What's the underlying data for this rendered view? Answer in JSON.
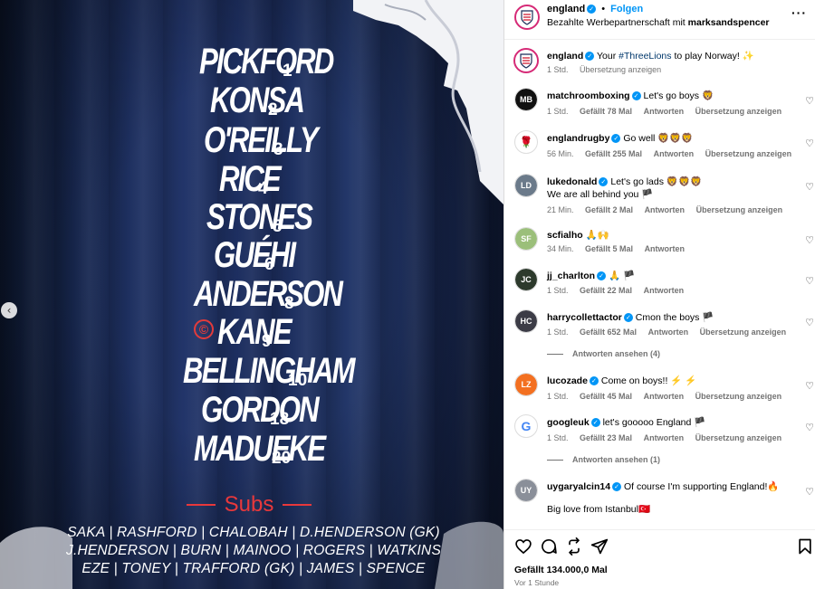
{
  "post_image": {
    "starting_xi": [
      {
        "name": "PICKFORD",
        "number": "1"
      },
      {
        "name": "KONSA",
        "number": "2"
      },
      {
        "name": "O'REILLY",
        "number": "3"
      },
      {
        "name": "RICE",
        "number": "4"
      },
      {
        "name": "STONES",
        "number": "5"
      },
      {
        "name": "GUÉHI",
        "number": "6"
      },
      {
        "name": "ANDERSON",
        "number": "8"
      },
      {
        "name": "KANE",
        "number": "9"
      },
      {
        "name": "BELLINGHAM",
        "number": "10"
      },
      {
        "name": "GORDON",
        "number": "18"
      },
      {
        "name": "MADUEKE",
        "number": "20"
      }
    ],
    "captain_mark": "©",
    "subs_title": "Subs",
    "subs_lines": [
      "SAKA | RASHFORD | CHALOBAH | D.HENDERSON (GK)",
      "J.HENDERSON | BURN | MAINOO | ROGERS | WATKINS",
      "EZE | TONEY | TRAFFORD (GK) | JAMES | SPENCE"
    ],
    "carousel_prev_icon": "‹"
  },
  "header": {
    "username": "england",
    "follow_label": "Folgen",
    "separator": "•",
    "partnership_prefix": "Bezahlte Werbepartnerschaft mit",
    "partner": "marksandspencer",
    "more_icon": "···"
  },
  "caption": {
    "username": "england",
    "text_before": "Your",
    "hashtag": "#ThreeLions",
    "text_after": "to play Norway! ✨",
    "time": "1 Std.",
    "translate": "Übersetzung anzeigen"
  },
  "comments": [
    {
      "username": "matchroomboxing",
      "verified": true,
      "text": "Let's go boys 🦁",
      "time": "1 Std.",
      "likes": "Gefällt 78 Mal",
      "reply": "Antworten",
      "translate": "Übersetzung anzeigen",
      "avatar_color": "#111111",
      "avatar_text": "MB"
    },
    {
      "username": "englandrugby",
      "verified": true,
      "text": "Go well 🦁🦁🦁",
      "time": "56 Min.",
      "likes": "Gefällt 255 Mal",
      "reply": "Antworten",
      "translate": "Übersetzung anzeigen",
      "avatar_color": "#ffffff",
      "avatar_text": "🌹"
    },
    {
      "username": "lukedonald",
      "verified": true,
      "text": "Let's go lads 🦁🦁🦁",
      "text2": "We are all behind you 🏴",
      "time": "21 Min.",
      "likes": "Gefällt 2 Mal",
      "reply": "Antworten",
      "translate": "Übersetzung anzeigen",
      "avatar_color": "#6b7a8a",
      "avatar_text": "LD"
    },
    {
      "username": "scfialho",
      "verified": false,
      "text": "🙏🙌",
      "time": "34 Min.",
      "likes": "Gefällt 5 Mal",
      "reply": "Antworten",
      "avatar_color": "#9bbf7a",
      "avatar_text": "SF"
    },
    {
      "username": "jj_charlton",
      "verified": true,
      "text": "🙏 🏴",
      "time": "1 Std.",
      "likes": "Gefällt 22 Mal",
      "reply": "Antworten",
      "avatar_color": "#2d3a2c",
      "avatar_text": "JC"
    },
    {
      "username": "harrycollettactor",
      "verified": true,
      "text": "Cmon the boys 🏴",
      "time": "1 Std.",
      "likes": "Gefällt 652 Mal",
      "reply": "Antworten",
      "translate": "Übersetzung anzeigen",
      "view_replies": "Antworten ansehen (4)",
      "avatar_color": "#3c3c46",
      "avatar_text": "HC"
    },
    {
      "username": "lucozade",
      "verified": true,
      "text": "Come on boys!! ⚡ ⚡",
      "time": "1 Std.",
      "likes": "Gefällt 45 Mal",
      "reply": "Antworten",
      "translate": "Übersetzung anzeigen",
      "avatar_color": "#f37021",
      "avatar_text": "LZ"
    },
    {
      "username": "googleuk",
      "verified": true,
      "text": "let's gooooo England 🏴",
      "time": "1 Std.",
      "likes": "Gefällt 23 Mal",
      "reply": "Antworten",
      "translate": "Übersetzung anzeigen",
      "view_replies": "Antworten ansehen (1)",
      "avatar_color": "#ffffff",
      "avatar_text": "G"
    },
    {
      "username": "uygaryalcin14",
      "verified": true,
      "text": "Of course I'm supporting England!🔥",
      "text2": "Big love from Istanbul🇹🇷",
      "avatar_color": "#8a8f99",
      "avatar_text": "UY"
    }
  ],
  "actions": {
    "like_icon": "heart-icon",
    "comment_icon": "comment-icon",
    "share_icon": "repost-icon",
    "send_icon": "send-icon",
    "save_icon": "bookmark-icon",
    "likes_total": "Gefällt 134.000,0 Mal",
    "time": "Vor 1 Stunde"
  },
  "colors": {
    "accent_blue": "#0095f6",
    "hashtag": "#00376b",
    "subs_red": "#e8383b",
    "meta_grey": "#737373"
  }
}
